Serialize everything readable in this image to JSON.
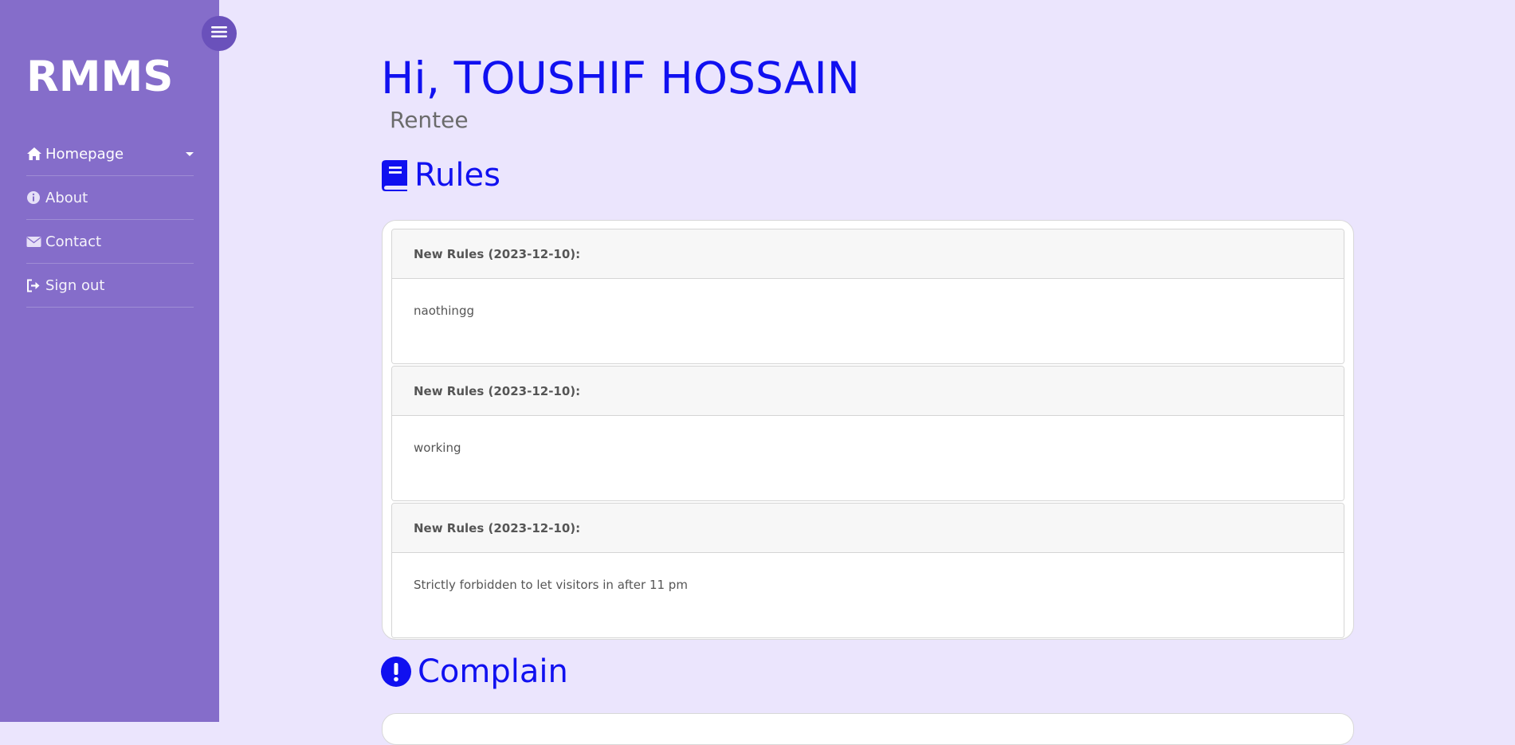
{
  "sidebar": {
    "brand": "RMMS",
    "items": [
      {
        "label": "Homepage",
        "icon": "home-icon"
      },
      {
        "label": "About",
        "icon": "info-icon"
      },
      {
        "label": "Contact",
        "icon": "envelope-icon"
      },
      {
        "label": "Sign out",
        "icon": "sign-out-icon"
      }
    ]
  },
  "main": {
    "greeting": "Hi, TOUSHIF HOSSAIN",
    "role": "Rentee",
    "rules_title": "Rules",
    "rules": [
      {
        "header": "New Rules (2023-12-10):",
        "body": "naothingg"
      },
      {
        "header": "New Rules (2023-12-10):",
        "body": "working"
      },
      {
        "header": "New Rules (2023-12-10):",
        "body": "Strictly forbidden to let visitors in after 11 pm"
      }
    ],
    "complain_title": "Complain"
  },
  "colors": {
    "sidebar_bg": "#856dca",
    "page_bg": "#ebe5fd",
    "accent_blue": "#1010f0",
    "toggle_bg": "#6a51bb"
  }
}
